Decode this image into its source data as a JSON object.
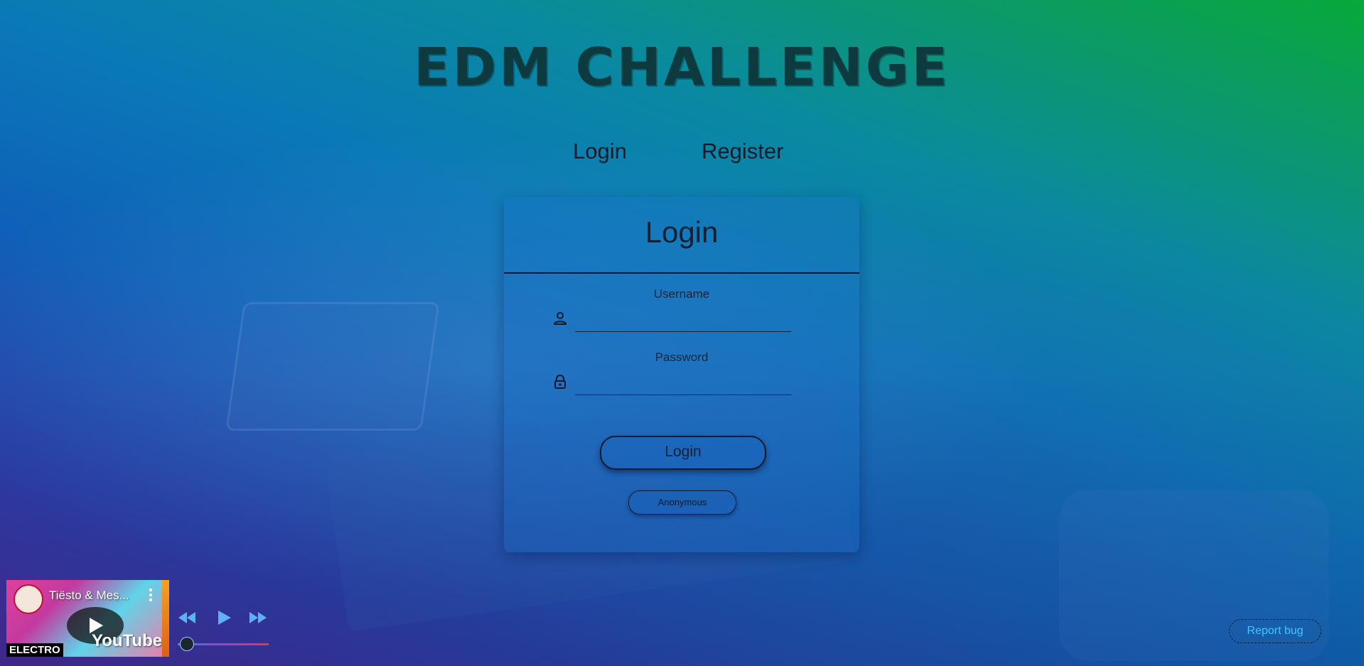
{
  "header": {
    "title": "EDM CHALLENGE"
  },
  "tabs": [
    {
      "label": "Login"
    },
    {
      "label": "Register"
    }
  ],
  "login_card": {
    "title": "Login",
    "username_label": "Username",
    "username_value": "",
    "password_label": "Password",
    "password_value": "",
    "submit_label": "Login",
    "anonymous_label": "Anonymous",
    "username_icon": "user-icon",
    "password_icon": "lock-icon"
  },
  "player": {
    "video_title": "Tiësto & Mes...",
    "brand": "YouTube",
    "genre": "ELECTRO",
    "controls": [
      "rewind-icon",
      "play-icon",
      "fast-forward-icon"
    ],
    "progress": 0.1
  },
  "footer": {
    "report_bug_label": "Report bug"
  },
  "colors": {
    "text_dark": "#132033",
    "report_bug": "#3fc8ff",
    "gradient_top_right": "#08a83a",
    "gradient_bottom_left": "#4a2a96"
  }
}
